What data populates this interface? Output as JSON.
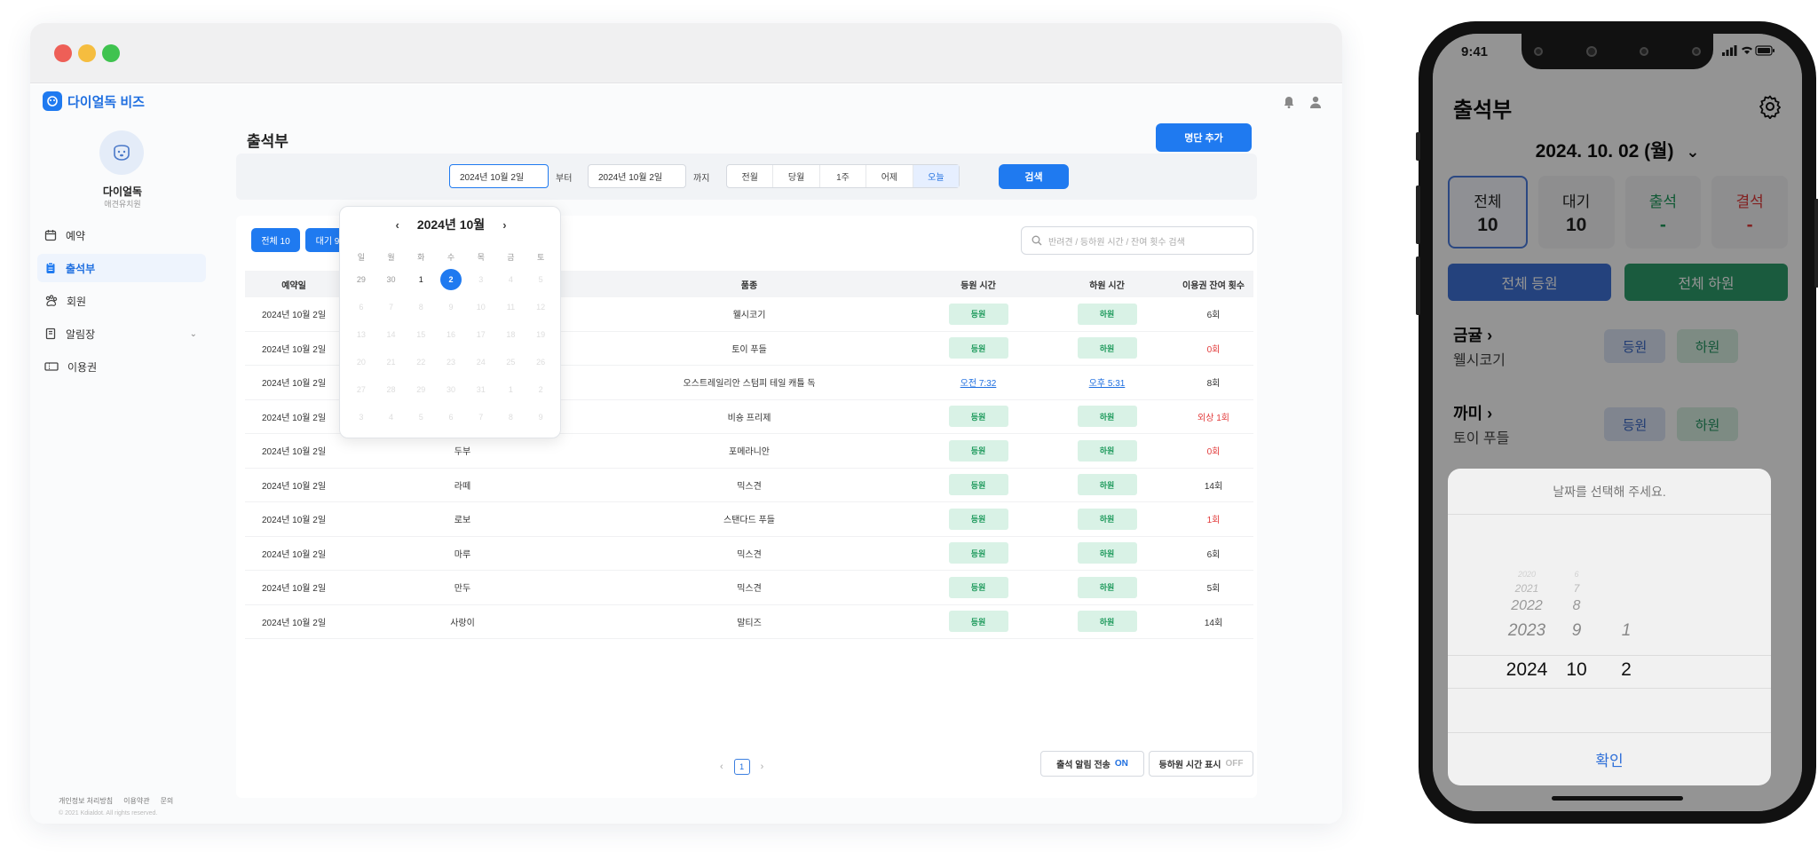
{
  "desktop": {
    "logo_text": "다이얼독 비즈",
    "profile": {
      "name": "다이얼독",
      "sub": "애견유치원"
    },
    "nav": [
      {
        "label": "예약"
      },
      {
        "label": "출석부"
      },
      {
        "label": "회원"
      },
      {
        "label": "알림장"
      },
      {
        "label": "이용권"
      }
    ],
    "footer_links": [
      "개인정보 처리방침",
      "이용약관",
      "문의"
    ],
    "footer_copy": "© 2021 Kdialdot. All rights reserved.",
    "page_title": "출석부",
    "add_button": "명단 추가",
    "filter": {
      "from_value": "2024년 10월 2일",
      "from_suffix": "부터",
      "to_value": "2024년 10월 2일",
      "to_suffix": "까지",
      "ranges": [
        "전월",
        "당월",
        "1주",
        "어제",
        "오늘"
      ],
      "search_button": "검색"
    },
    "chips": [
      "전체 10",
      "대기 9"
    ],
    "table_search_placeholder": "반려견 / 등하원 시간 / 잔여 횟수 검색",
    "columns": [
      "예약일",
      "",
      "품종",
      "등원 시간",
      "하원 시간",
      "이용권 잔여 횟수"
    ],
    "checkin_label": "등원",
    "checkout_label": "하원",
    "rows": [
      {
        "date": "2024년 10월 2일",
        "name": "",
        "breed": "웰시코기",
        "in": "",
        "out": "",
        "remain": "6회",
        "remain_red": false
      },
      {
        "date": "2024년 10월 2일",
        "name": "",
        "breed": "토이 푸들",
        "in": "",
        "out": "",
        "remain": "0회",
        "remain_red": true
      },
      {
        "date": "2024년 10월 2일",
        "name": "",
        "breed": "오스트레일리안 스텀피 테일 캐틀 독",
        "in": "오전 7:32",
        "out": "오후 5:31",
        "remain": "8회",
        "remain_red": false
      },
      {
        "date": "2024년 10월 2일",
        "name": "",
        "breed": "비숑 프리제",
        "in": "",
        "out": "",
        "remain": "외상 1회",
        "remain_red": true
      },
      {
        "date": "2024년 10월 2일",
        "name": "두부",
        "breed": "포메라니안",
        "in": "",
        "out": "",
        "remain": "0회",
        "remain_red": true
      },
      {
        "date": "2024년 10월 2일",
        "name": "라떼",
        "breed": "믹스견",
        "in": "",
        "out": "",
        "remain": "14회",
        "remain_red": false
      },
      {
        "date": "2024년 10월 2일",
        "name": "로보",
        "breed": "스탠다드 푸들",
        "in": "",
        "out": "",
        "remain": "1회",
        "remain_red": true
      },
      {
        "date": "2024년 10월 2일",
        "name": "마루",
        "breed": "믹스견",
        "in": "",
        "out": "",
        "remain": "6회",
        "remain_red": false
      },
      {
        "date": "2024년 10월 2일",
        "name": "만두",
        "breed": "믹스견",
        "in": "",
        "out": "",
        "remain": "5회",
        "remain_red": false
      },
      {
        "date": "2024년 10월 2일",
        "name": "사랑이",
        "breed": "말티즈",
        "in": "",
        "out": "",
        "remain": "14회",
        "remain_red": false
      }
    ],
    "pagination": {
      "prev": "‹",
      "current": "1",
      "next": "›"
    },
    "toggle_notify": {
      "label": "출석 알림 전송",
      "state": "ON"
    },
    "toggle_time": {
      "label": "등하원 시간 표시",
      "state": "OFF"
    },
    "calendar": {
      "title": "2024년 10월",
      "weekdays": [
        "일",
        "월",
        "화",
        "수",
        "목",
        "금",
        "토"
      ],
      "days": [
        "29",
        "30",
        "1",
        "2",
        "3",
        "4",
        "5",
        "6",
        "7",
        "8",
        "9",
        "10",
        "11",
        "12",
        "13",
        "14",
        "15",
        "16",
        "17",
        "18",
        "19",
        "20",
        "21",
        "22",
        "23",
        "24",
        "25",
        "26",
        "27",
        "28",
        "29",
        "30",
        "31",
        "1",
        "2",
        "3",
        "4",
        "5",
        "6",
        "7",
        "8",
        "9"
      ],
      "selected": "2"
    }
  },
  "mobile": {
    "time": "9:41",
    "title": "출석부",
    "date": "2024. 10. 02 (월)",
    "tiles": [
      {
        "label": "전체",
        "value": "10",
        "color": "#222222"
      },
      {
        "label": "대기",
        "value": "10",
        "color": "#222222"
      },
      {
        "label": "출석",
        "value": "-",
        "color": "#1e9a5c"
      },
      {
        "label": "결석",
        "value": "-",
        "color": "#e23a3a"
      }
    ],
    "all_in": "전체 등원",
    "all_out": "전체 하원",
    "pets": [
      {
        "name": "금귤",
        "breed": "웰시코기"
      },
      {
        "name": "까미",
        "breed": "토이 푸들"
      }
    ],
    "pet_in": "등원",
    "pet_out": "하원",
    "sheet_title": "날짜를 선택해 주세요.",
    "picker_years": [
      "2020",
      "2021",
      "2022",
      "2023",
      "2024"
    ],
    "picker_months": [
      "6",
      "7",
      "8",
      "9",
      "10"
    ],
    "picker_days": [
      "1",
      "2"
    ],
    "confirm": "확인"
  },
  "colors": {
    "primary": "#1f7af0",
    "green": "#2e9e6b",
    "blue_btn": "#3f72d8",
    "red": "#e23a3a"
  }
}
